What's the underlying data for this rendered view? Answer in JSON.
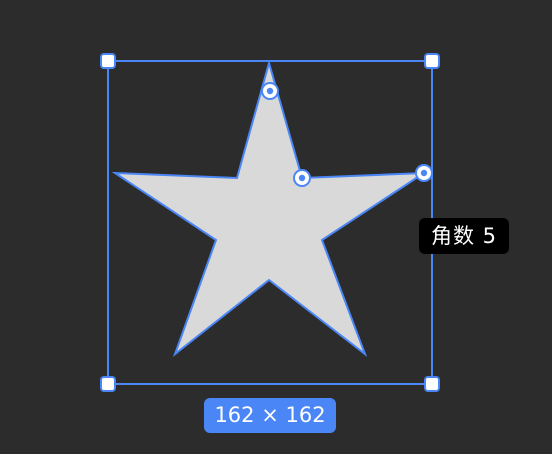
{
  "canvas": {
    "background": "#2c2c2c"
  },
  "selection": {
    "accent_color": "#4a86f5",
    "star_fill": "#d9d9d9",
    "star_points": 5
  },
  "tooltip": {
    "points_label": "角数 5"
  },
  "size_badge": {
    "label": "162 × 162"
  }
}
